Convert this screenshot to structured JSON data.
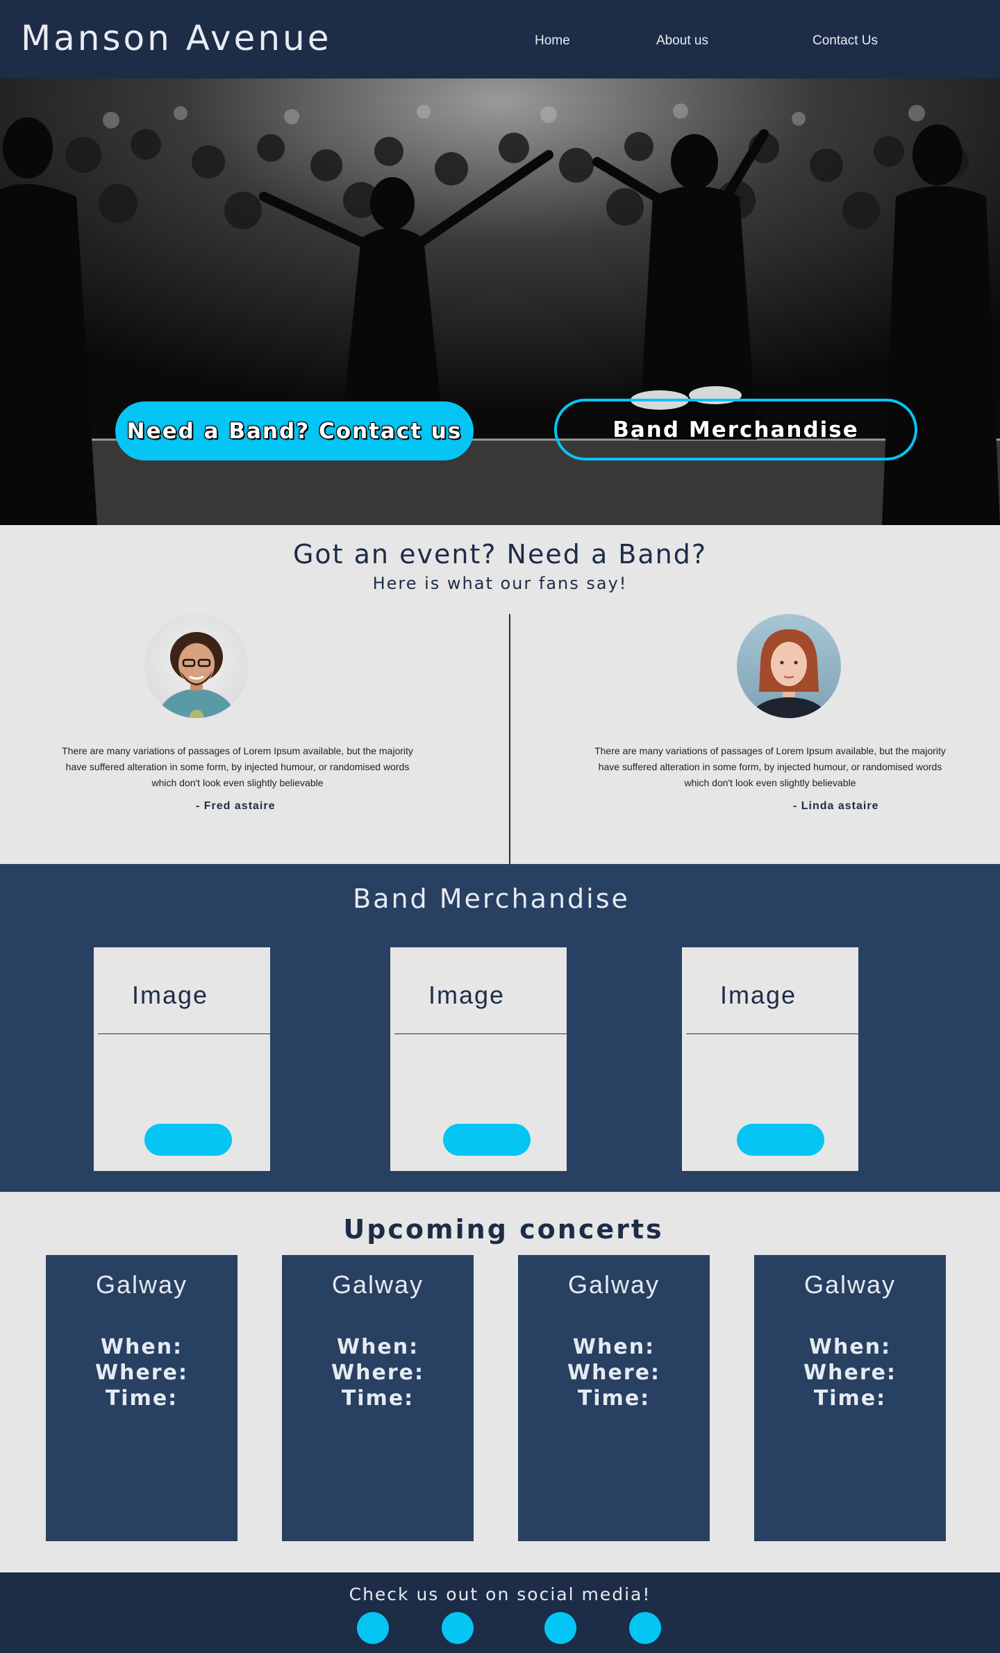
{
  "header": {
    "brand": "Manson Avenue",
    "nav": {
      "home": "Home",
      "about": "About us",
      "contact": "Contact Us"
    }
  },
  "hero": {
    "contact_button": "Need a Band? Contact us",
    "merch_button": "Band Merchandise"
  },
  "testimonials": {
    "title": "Got an event? Need a Band?",
    "subtitle": "Here is what our fans say!",
    "items": [
      {
        "quote": "There are many variations of passages of Lorem Ipsum available, but the majority have suffered alteration in some form, by injected humour, or randomised words which don't look even slightly believable",
        "author": "- Fred astaire"
      },
      {
        "quote": "There are many variations of passages of Lorem Ipsum available, but the majority have suffered alteration in some form, by injected humour, or randomised words which don't look even slightly believable",
        "author": "- Linda astaire"
      }
    ]
  },
  "merch": {
    "title": "Band Merchandise",
    "cards": [
      {
        "label": "Image"
      },
      {
        "label": "Image"
      },
      {
        "label": "Image"
      }
    ]
  },
  "concerts": {
    "title": "Upcoming concerts",
    "items": [
      {
        "city": "Galway",
        "when": "When:",
        "where": "Where:",
        "time": "Time:"
      },
      {
        "city": "Galway",
        "when": "When:",
        "where": "Where:",
        "time": "Time:"
      },
      {
        "city": "Galway",
        "when": "When:",
        "where": "Where:",
        "time": "Time:"
      },
      {
        "city": "Galway",
        "when": "When:",
        "where": "Where:",
        "time": "Time:"
      }
    ]
  },
  "footer": {
    "social_text": "Check us out on social media!",
    "social_icons": [
      "social-icon",
      "social-icon",
      "social-icon",
      "social-icon"
    ]
  },
  "colors": {
    "header_bg": "#1d2c47",
    "section_dark": "#284061",
    "accent": "#05c5f5",
    "light_bg": "#e6e6e6"
  }
}
